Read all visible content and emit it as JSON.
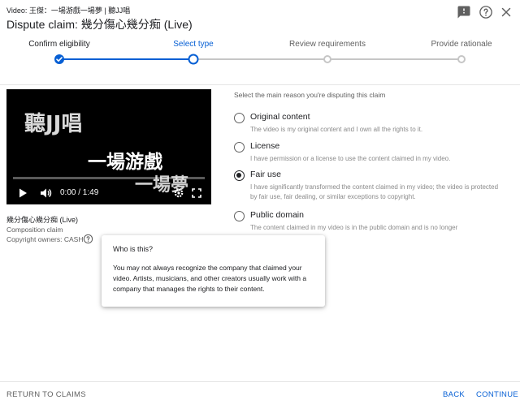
{
  "header": {
    "video_line": "Video: 王傑：一場游戲一場夢 | 聽JJ唱",
    "title": "Dispute claim: 幾分傷心幾分痴 (Live)",
    "icons": [
      "feedback-icon",
      "help-icon",
      "close-icon"
    ]
  },
  "stepper": {
    "steps": [
      {
        "label": "Confirm eligibility",
        "state": "done"
      },
      {
        "label": "Select type",
        "state": "active"
      },
      {
        "label": "Review requirements",
        "state": "todo"
      },
      {
        "label": "Provide rationale",
        "state": "todo"
      }
    ]
  },
  "video": {
    "overlay_line1": "聽JJ唱",
    "overlay_line2": "一場游戲",
    "overlay_line3": "一場夢",
    "time": "0:00 / 1:49",
    "progress": 0
  },
  "claim": {
    "title": "幾分傷心幾分痴 (Live)",
    "type": "Composition claim",
    "owners": "Copyright owners: CASH"
  },
  "options": {
    "instruction": "Select the main reason you're disputing this claim",
    "items": [
      {
        "label": "Original content",
        "desc": "The video is my original content and I own all the rights to it.",
        "checked": false
      },
      {
        "label": "License",
        "desc": "I have permission or a license to use the content claimed in my video.",
        "checked": false
      },
      {
        "label": "Fair use",
        "desc": "I have significantly transformed the content claimed in my video; the video is protected by fair use, fair dealing, or similar exceptions to copyright.",
        "checked": true
      },
      {
        "label": "Public domain",
        "desc": "The content claimed in my video is in the public domain and is no longer",
        "checked": false
      }
    ]
  },
  "tooltip": {
    "title": "Who is this?",
    "body": "You may not always recognize the company that claimed your video. Artists, musicians, and other creators usually work with a company that manages the rights to their content."
  },
  "footer": {
    "return_label": "RETURN TO CLAIMS",
    "back_label": "BACK",
    "continue_label": "CONTINUE"
  },
  "colors": {
    "accent": "#065fd4",
    "inactive": "#c6c6c6"
  }
}
